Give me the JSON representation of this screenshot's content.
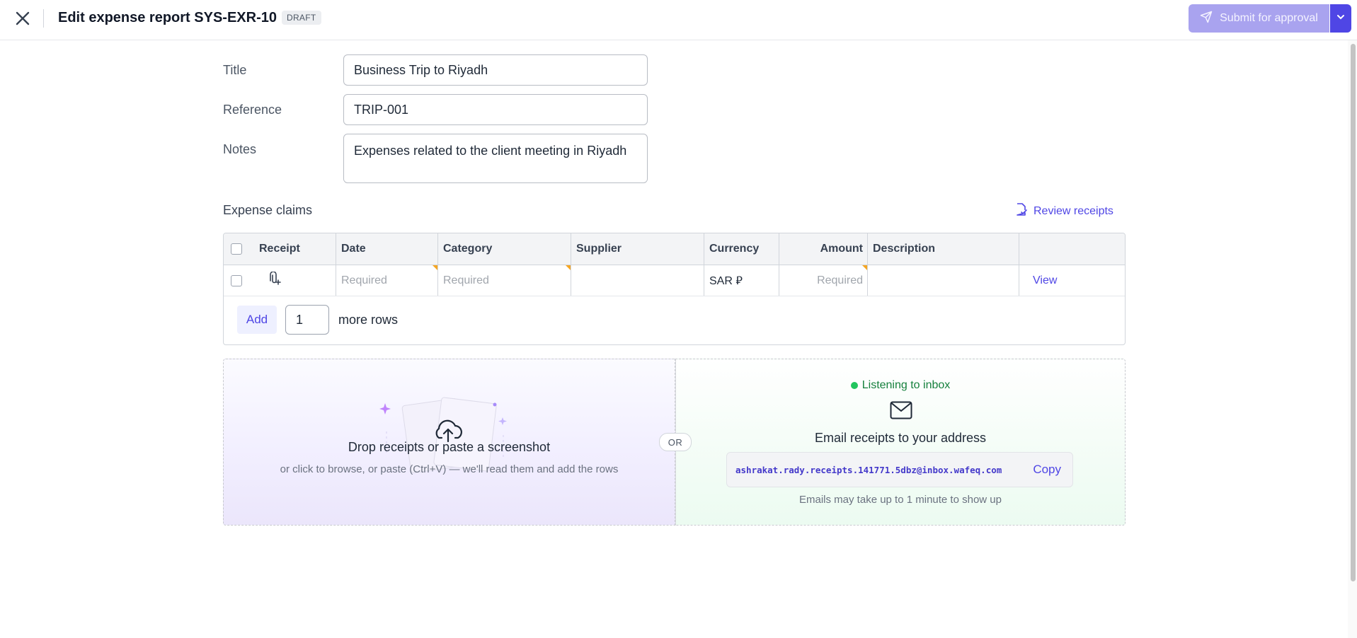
{
  "header": {
    "title": "Edit expense report SYS-EXR-10",
    "status_badge": "DRAFT",
    "submit_label": "Submit for approval"
  },
  "form": {
    "title_label": "Title",
    "title_value": "Business Trip to Riyadh",
    "reference_label": "Reference",
    "reference_value": "TRIP-001",
    "notes_label": "Notes",
    "notes_value": "Expenses related to the client meeting in Riyadh"
  },
  "claims": {
    "section_title": "Expense claims",
    "review_label": "Review receipts",
    "columns": {
      "receipt": "Receipt",
      "date": "Date",
      "category": "Category",
      "supplier": "Supplier",
      "currency": "Currency",
      "amount": "Amount",
      "description": "Description"
    },
    "rows": [
      {
        "date": "Required",
        "category": "Required",
        "supplier": "",
        "currency": "SAR ⃁",
        "amount": "Required",
        "description": "",
        "action": "View"
      }
    ],
    "add_label": "Add",
    "add_count": "1",
    "more_rows_label": "more rows"
  },
  "upload": {
    "title": "Drop receipts or paste a screenshot",
    "subtitle": "or click to browse, or paste (Ctrl+V) — we'll read them and add the rows",
    "or_label": "OR"
  },
  "email": {
    "status": "Listening to inbox",
    "title": "Email receipts to your address",
    "address": "ashrakat.rady.receipts.141771.5dbz@inbox.wafeq.com",
    "copy_label": "Copy",
    "note": "Emails may take up to 1 minute to show up"
  },
  "colors": {
    "accent": "#4f46e5",
    "accent_disabled": "#a9a3ef",
    "success": "#22c55e",
    "required_flag": "#f5a623"
  },
  "icons": {
    "close": "close-icon",
    "submit": "send-icon",
    "caret": "chevron-down-icon",
    "review": "receipt-check-icon",
    "attach": "paperclip-add-icon",
    "upload": "cloud-upload-icon",
    "mail": "envelope-icon"
  }
}
